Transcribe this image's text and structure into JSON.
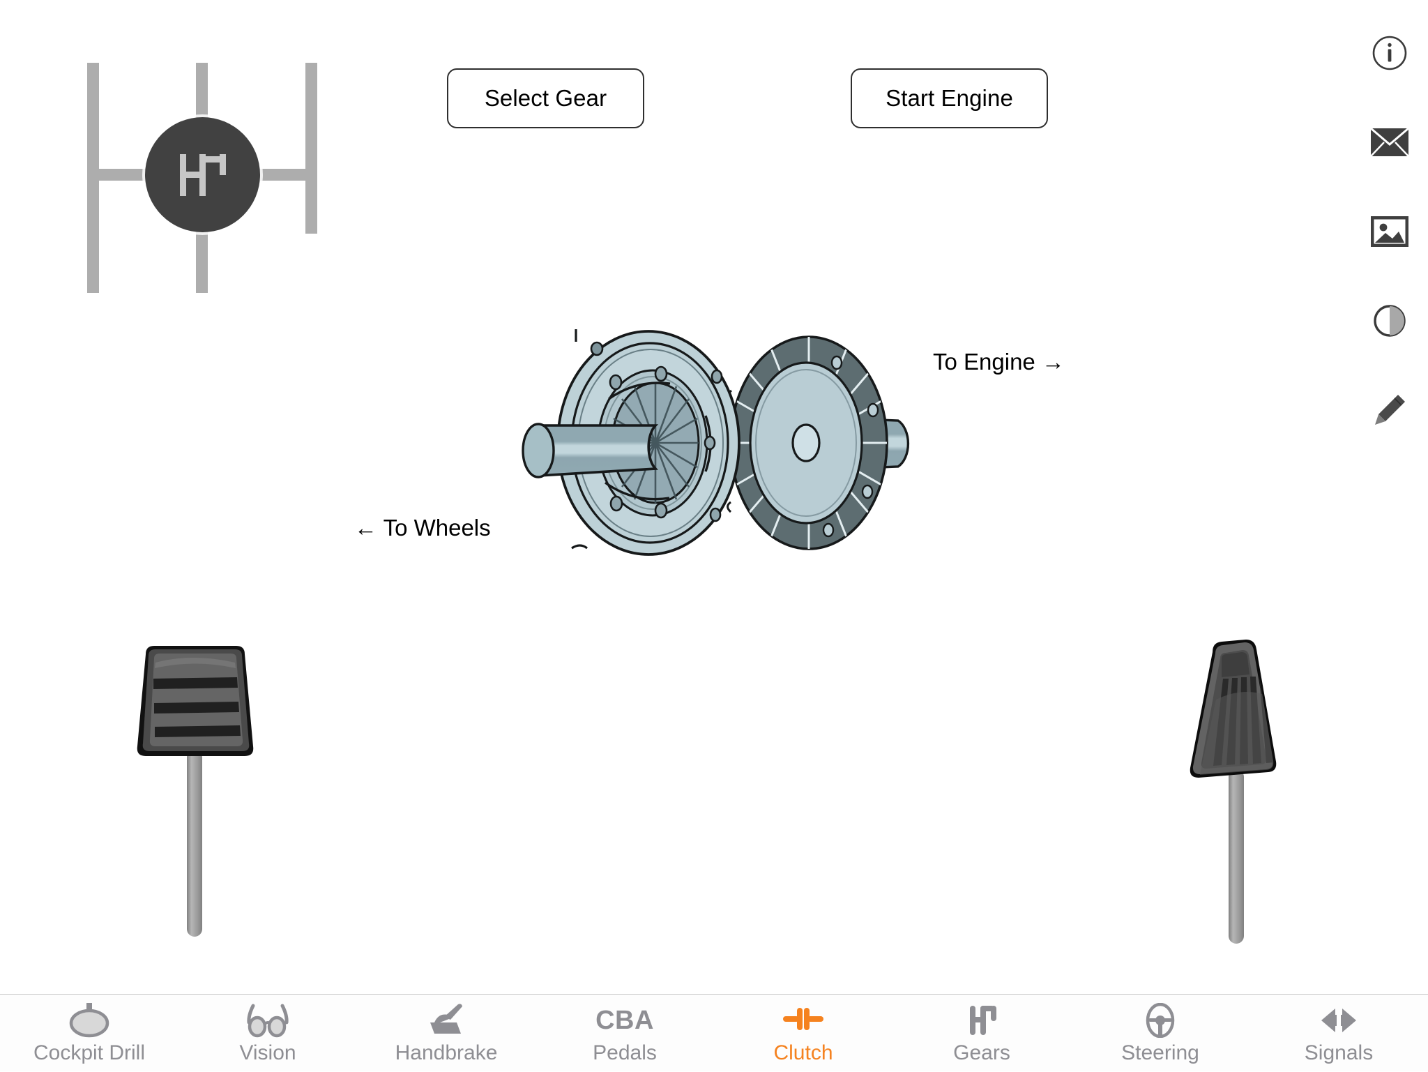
{
  "app": {
    "background_color": "#ffffff",
    "accent_color": "#f5821f",
    "inactive_color": "#8e8e93"
  },
  "gear_selector": {
    "name": "gear-gate",
    "knob_glyph": "H-pattern",
    "gate_color": "#adadad",
    "knob_color": "#414141"
  },
  "buttons": {
    "select_gear": "Select Gear",
    "start_engine": "Start Engine"
  },
  "toolbar": {
    "items": [
      {
        "name": "info-icon",
        "label": "Info"
      },
      {
        "name": "mail-icon",
        "label": "Mail"
      },
      {
        "name": "image-icon",
        "label": "Image"
      },
      {
        "name": "contrast-icon",
        "label": "Contrast"
      },
      {
        "name": "pencil-icon",
        "label": "Draw"
      }
    ]
  },
  "illustration": {
    "title": "Clutch assembly",
    "label_left": "← To Wheels",
    "label_right": "To Engine →",
    "colors": {
      "plate_light": "#b9cdd4",
      "plate_mid": "#8da7b0",
      "segment_dark": "#5d6d71",
      "shaft": "#8fabb3",
      "outline": "#16191a"
    }
  },
  "pedals": {
    "left": {
      "name": "clutch-pedal",
      "type": "clutch"
    },
    "right": {
      "name": "accelerator-pedal",
      "type": "accelerator"
    }
  },
  "tabbar": {
    "active_index": 4,
    "tabs": [
      {
        "label": "Cockpit Drill",
        "icon": "mirror-icon"
      },
      {
        "label": "Vision",
        "icon": "glasses-icon"
      },
      {
        "label": "Handbrake",
        "icon": "handbrake-icon"
      },
      {
        "label": "Pedals",
        "icon": "cba-icon",
        "icon_text": "CBA"
      },
      {
        "label": "Clutch",
        "icon": "clutch-icon"
      },
      {
        "label": "Gears",
        "icon": "gear-stick-icon"
      },
      {
        "label": "Steering",
        "icon": "steering-wheel-icon"
      },
      {
        "label": "Signals",
        "icon": "indicators-icon"
      }
    ]
  }
}
